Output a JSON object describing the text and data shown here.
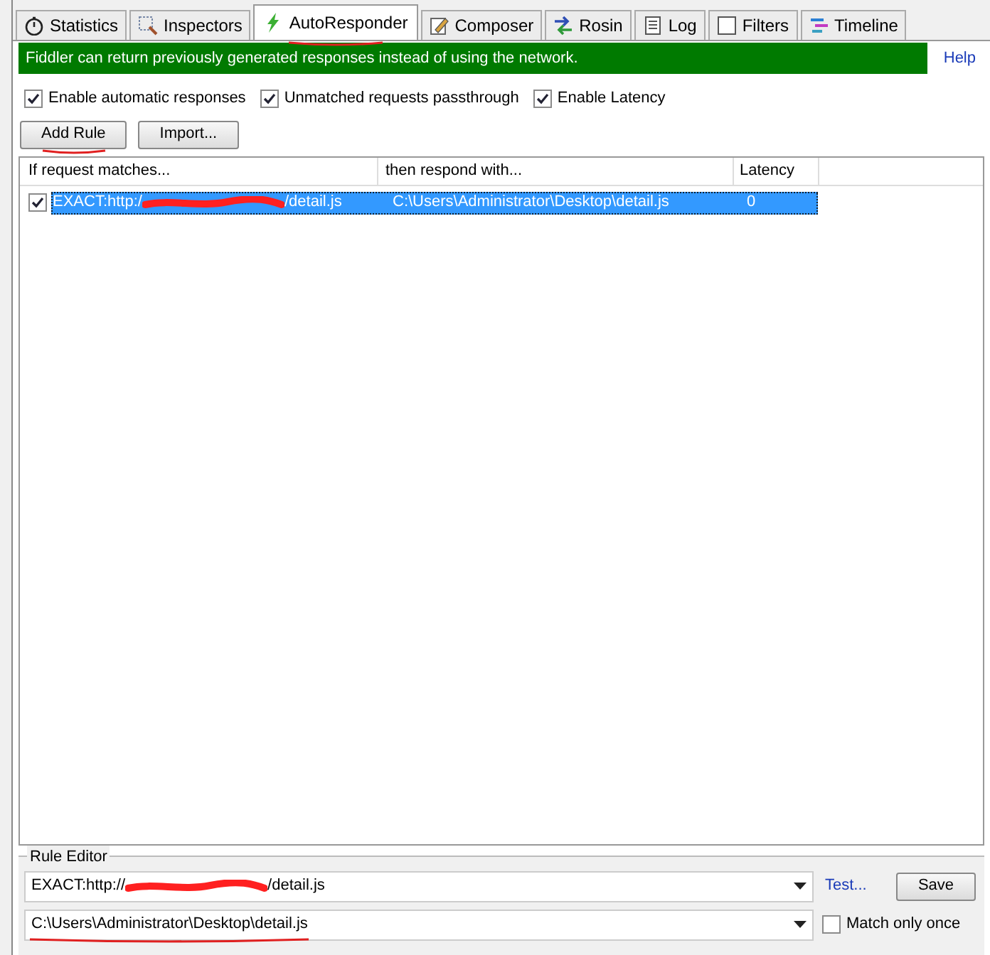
{
  "tabs": [
    {
      "label": "Statistics",
      "kind": "stopwatch",
      "selected": false
    },
    {
      "label": "Inspectors",
      "kind": "magnifier",
      "selected": false
    },
    {
      "label": "AutoResponder",
      "kind": "bolt",
      "selected": true
    },
    {
      "label": "Composer",
      "kind": "pencil",
      "selected": false
    },
    {
      "label": "Rosin",
      "kind": "arrows",
      "selected": false
    },
    {
      "label": "Log",
      "kind": "document",
      "selected": false
    },
    {
      "label": "Filters",
      "kind": "square",
      "selected": false
    },
    {
      "label": "Timeline",
      "kind": "bars",
      "selected": false
    }
  ],
  "banner": {
    "text": "Fiddler can return previously generated responses instead of using the network.",
    "link": "Help"
  },
  "options": [
    {
      "label": "Enable automatic responses",
      "checked": true
    },
    {
      "label": "Unmatched requests passthrough",
      "checked": true
    },
    {
      "label": "Enable Latency",
      "checked": true
    }
  ],
  "buttons": [
    "Add Rule",
    "Import..."
  ],
  "table": {
    "columns": [
      "If request matches...",
      "then respond with...",
      "Latency"
    ],
    "rows": [
      {
        "checked": true,
        "selected": true,
        "match_start": "EXACT:http:/",
        "match_end": "/detail.js",
        "respond": "C:\\Users\\Administrator\\Desktop\\detail.js",
        "latency": "0"
      }
    ]
  },
  "rule_editor": {
    "title": "Rule Editor",
    "match_start": "EXACT:http://",
    "match_end": "/detail.js",
    "test_link": "Test...",
    "save": "Save",
    "respond": "C:\\Users\\Administrator\\Desktop\\detail.js",
    "match_once": {
      "label": "Match only once",
      "checked": false
    }
  }
}
